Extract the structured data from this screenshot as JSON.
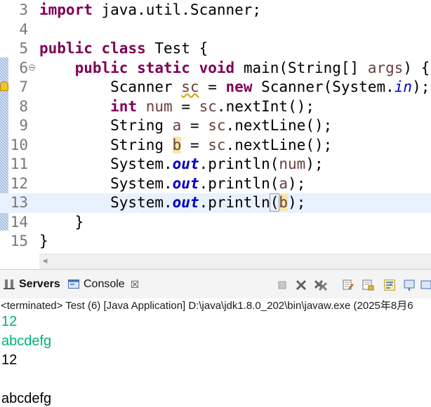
{
  "editor": {
    "lines": [
      {
        "num": "3",
        "parts": [
          {
            "t": "import",
            "c": "kw"
          },
          {
            "t": " java.util.Scanner;"
          }
        ]
      },
      {
        "num": "4",
        "parts": []
      },
      {
        "num": "5",
        "parts": [
          {
            "t": "public",
            "c": "kw"
          },
          {
            "t": " "
          },
          {
            "t": "class",
            "c": "kw"
          },
          {
            "t": " Test {"
          }
        ]
      },
      {
        "num": "6",
        "fold": true,
        "parts": [
          {
            "t": "    "
          },
          {
            "t": "public",
            "c": "kw"
          },
          {
            "t": " "
          },
          {
            "t": "static",
            "c": "kw"
          },
          {
            "t": " "
          },
          {
            "t": "void",
            "c": "kw"
          },
          {
            "t": " main(String[] "
          },
          {
            "t": "args",
            "c": "var"
          },
          {
            "t": ") {"
          }
        ]
      },
      {
        "num": "7",
        "parts": [
          {
            "t": "        Scanner "
          },
          {
            "t": "sc",
            "c": "var squiggle"
          },
          {
            "t": " = "
          },
          {
            "t": "new",
            "c": "kw"
          },
          {
            "t": " Scanner(System."
          },
          {
            "t": "in",
            "c": "fieldin"
          },
          {
            "t": ");"
          }
        ]
      },
      {
        "num": "8",
        "parts": [
          {
            "t": "        "
          },
          {
            "t": "int",
            "c": "kw"
          },
          {
            "t": " "
          },
          {
            "t": "num",
            "c": "var"
          },
          {
            "t": " = "
          },
          {
            "t": "sc",
            "c": "var"
          },
          {
            "t": ".nextInt();"
          }
        ]
      },
      {
        "num": "9",
        "parts": [
          {
            "t": "        String "
          },
          {
            "t": "a",
            "c": "var"
          },
          {
            "t": " = "
          },
          {
            "t": "sc",
            "c": "var"
          },
          {
            "t": ".nextLine();"
          }
        ]
      },
      {
        "num": "10",
        "parts": [
          {
            "t": "        String "
          },
          {
            "t": "b",
            "c": "var hl"
          },
          {
            "t": " = "
          },
          {
            "t": "sc",
            "c": "var"
          },
          {
            "t": ".nextLine();"
          }
        ]
      },
      {
        "num": "11",
        "parts": [
          {
            "t": "        System."
          },
          {
            "t": "out",
            "c": "field"
          },
          {
            "t": ".println("
          },
          {
            "t": "num",
            "c": "var"
          },
          {
            "t": ");"
          }
        ]
      },
      {
        "num": "12",
        "parts": [
          {
            "t": "        System."
          },
          {
            "t": "out",
            "c": "field"
          },
          {
            "t": ".println("
          },
          {
            "t": "a",
            "c": "var"
          },
          {
            "t": ");"
          }
        ]
      },
      {
        "num": "13",
        "current": true,
        "parts": [
          {
            "t": "        System."
          },
          {
            "t": "out",
            "c": "field"
          },
          {
            "t": ".println"
          },
          {
            "t": "(",
            "c": "bracket"
          },
          {
            "t": "b",
            "c": "var hl"
          },
          {
            "t": ");"
          }
        ]
      },
      {
        "num": "14",
        "parts": [
          {
            "t": "    }"
          }
        ]
      },
      {
        "num": "15",
        "parts": [
          {
            "t": "}"
          }
        ]
      }
    ]
  },
  "views": {
    "servers_label": "Servers",
    "console_label": "Console",
    "console_close": "☒"
  },
  "console": {
    "header": "<terminated> Test (6) [Java Application] D:\\java\\jdk1.8.0_202\\bin\\javaw.exe  (2025年8月6",
    "output": [
      {
        "text": "12",
        "kind": "input-echo"
      },
      {
        "text": "abcdefg",
        "kind": "input-echo"
      },
      {
        "text": "12",
        "kind": "stdout"
      },
      {
        "text": "",
        "kind": "stdout"
      },
      {
        "text": "abcdefg",
        "kind": "stdout"
      }
    ]
  },
  "colors": {
    "keyword": "#7f0055",
    "variable": "#6a3e3e",
    "static_field": "#0000c0",
    "console_input": "#00b27a",
    "current_line": "#e8f2fe"
  },
  "icons": {
    "servers_tab": "servers-icon",
    "console_tab": "console-icon",
    "toolbar": [
      "terminate-icon",
      "remove-launch-icon",
      "remove-all-terminated-icon",
      "clear-console-icon",
      "scroll-lock-icon",
      "word-wrap-icon",
      "pin-console-icon",
      "display-selected-console-icon"
    ]
  }
}
